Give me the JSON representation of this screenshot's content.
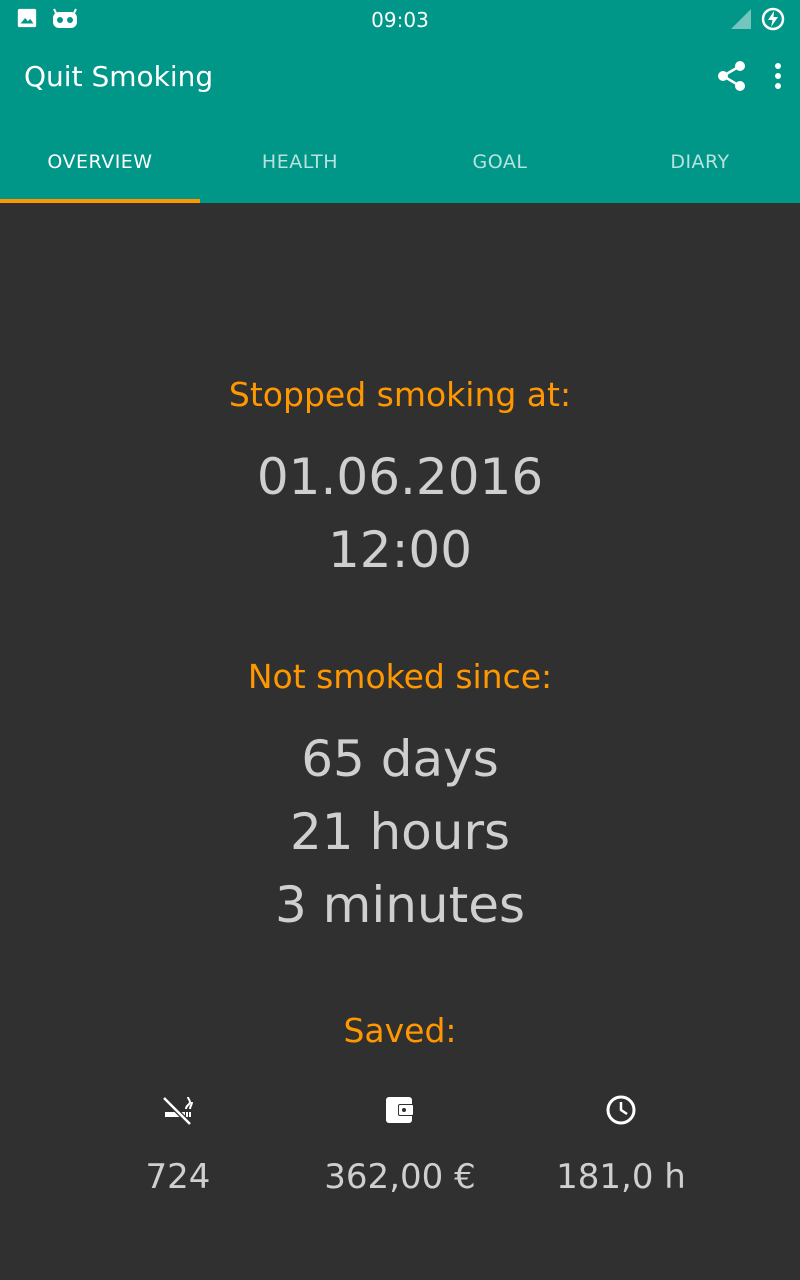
{
  "status_bar": {
    "time": "09:03",
    "left_icons": [
      "image-icon",
      "android-icon"
    ],
    "right_icons": [
      "signal-icon",
      "battery-charging-icon"
    ]
  },
  "toolbar": {
    "title": "Quit Smoking",
    "actions": [
      "share-icon",
      "more-vert-icon"
    ]
  },
  "tabs": [
    {
      "label": "OVERVIEW",
      "active": true
    },
    {
      "label": "HEALTH",
      "active": false
    },
    {
      "label": "GOAL",
      "active": false
    },
    {
      "label": "DIARY",
      "active": false
    }
  ],
  "overview": {
    "stopped_label": "Stopped smoking at:",
    "stopped_date": "01.06.2016",
    "stopped_time": "12:00",
    "since_label": "Not smoked since:",
    "since_days": "65 days",
    "since_hours": "21 hours",
    "since_minutes": "3 minutes",
    "saved_label": "Saved:",
    "saved": [
      {
        "icon": "no-smoking-icon",
        "value": "724"
      },
      {
        "icon": "wallet-icon",
        "value": "362,00 €"
      },
      {
        "icon": "clock-icon",
        "value": "181,0 h"
      }
    ]
  },
  "colors": {
    "primary": "#009688",
    "accent": "#ff9800",
    "background": "#303030",
    "text": "#cfcfcf"
  }
}
